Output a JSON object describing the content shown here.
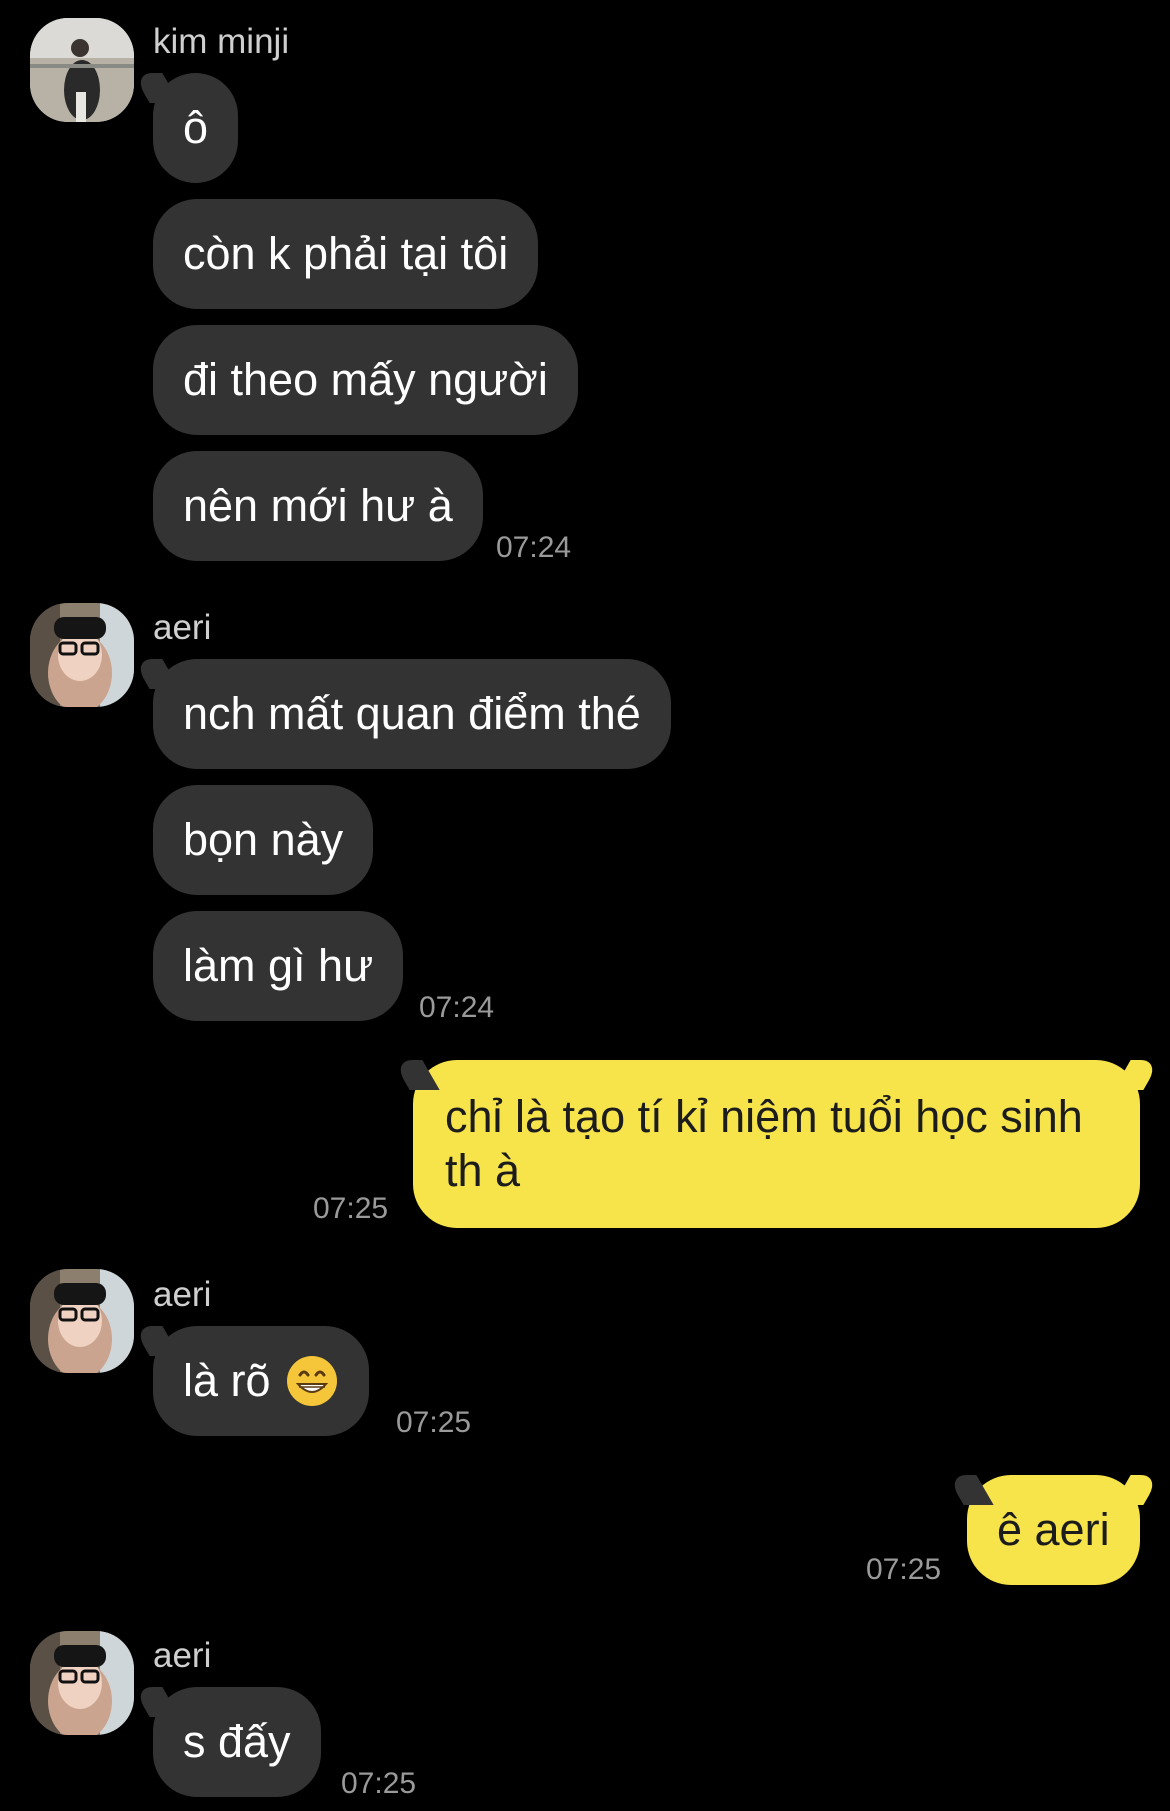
{
  "colors": {
    "background": "#000000",
    "incoming_bubble": "#333333",
    "outgoing_bubble": "#f7e34a",
    "timestamp": "#9a9a9a",
    "sender_name": "#cfcfcf"
  },
  "messages": [
    {
      "sender": "kim minji",
      "avatar_icon": "profile-photo-icon",
      "bubbles": [
        "ô",
        "còn k phải tại tôi",
        "đi theo mấy người",
        "nên mới hư à"
      ],
      "time": "07:24"
    },
    {
      "sender": "aeri",
      "avatar_icon": "profile-photo-icon",
      "bubbles": [
        "nch mất quan điểm thé",
        "bọn này",
        "làm gì hư"
      ],
      "time": "07:24"
    },
    {
      "outgoing": true,
      "bubbles": [
        "chỉ là tạo tí kỉ niệm tuổi học sinh th à"
      ],
      "time": "07:25"
    },
    {
      "sender": "aeri",
      "avatar_icon": "profile-photo-icon",
      "bubbles": [
        "là rõ"
      ],
      "emoji": "grinning-face-icon",
      "time": "07:25"
    },
    {
      "outgoing": true,
      "bubbles": [
        "ê aeri"
      ],
      "time": "07:25"
    },
    {
      "sender": "aeri",
      "avatar_icon": "profile-photo-icon",
      "bubbles": [
        "s đấy"
      ],
      "time": "07:25"
    }
  ]
}
